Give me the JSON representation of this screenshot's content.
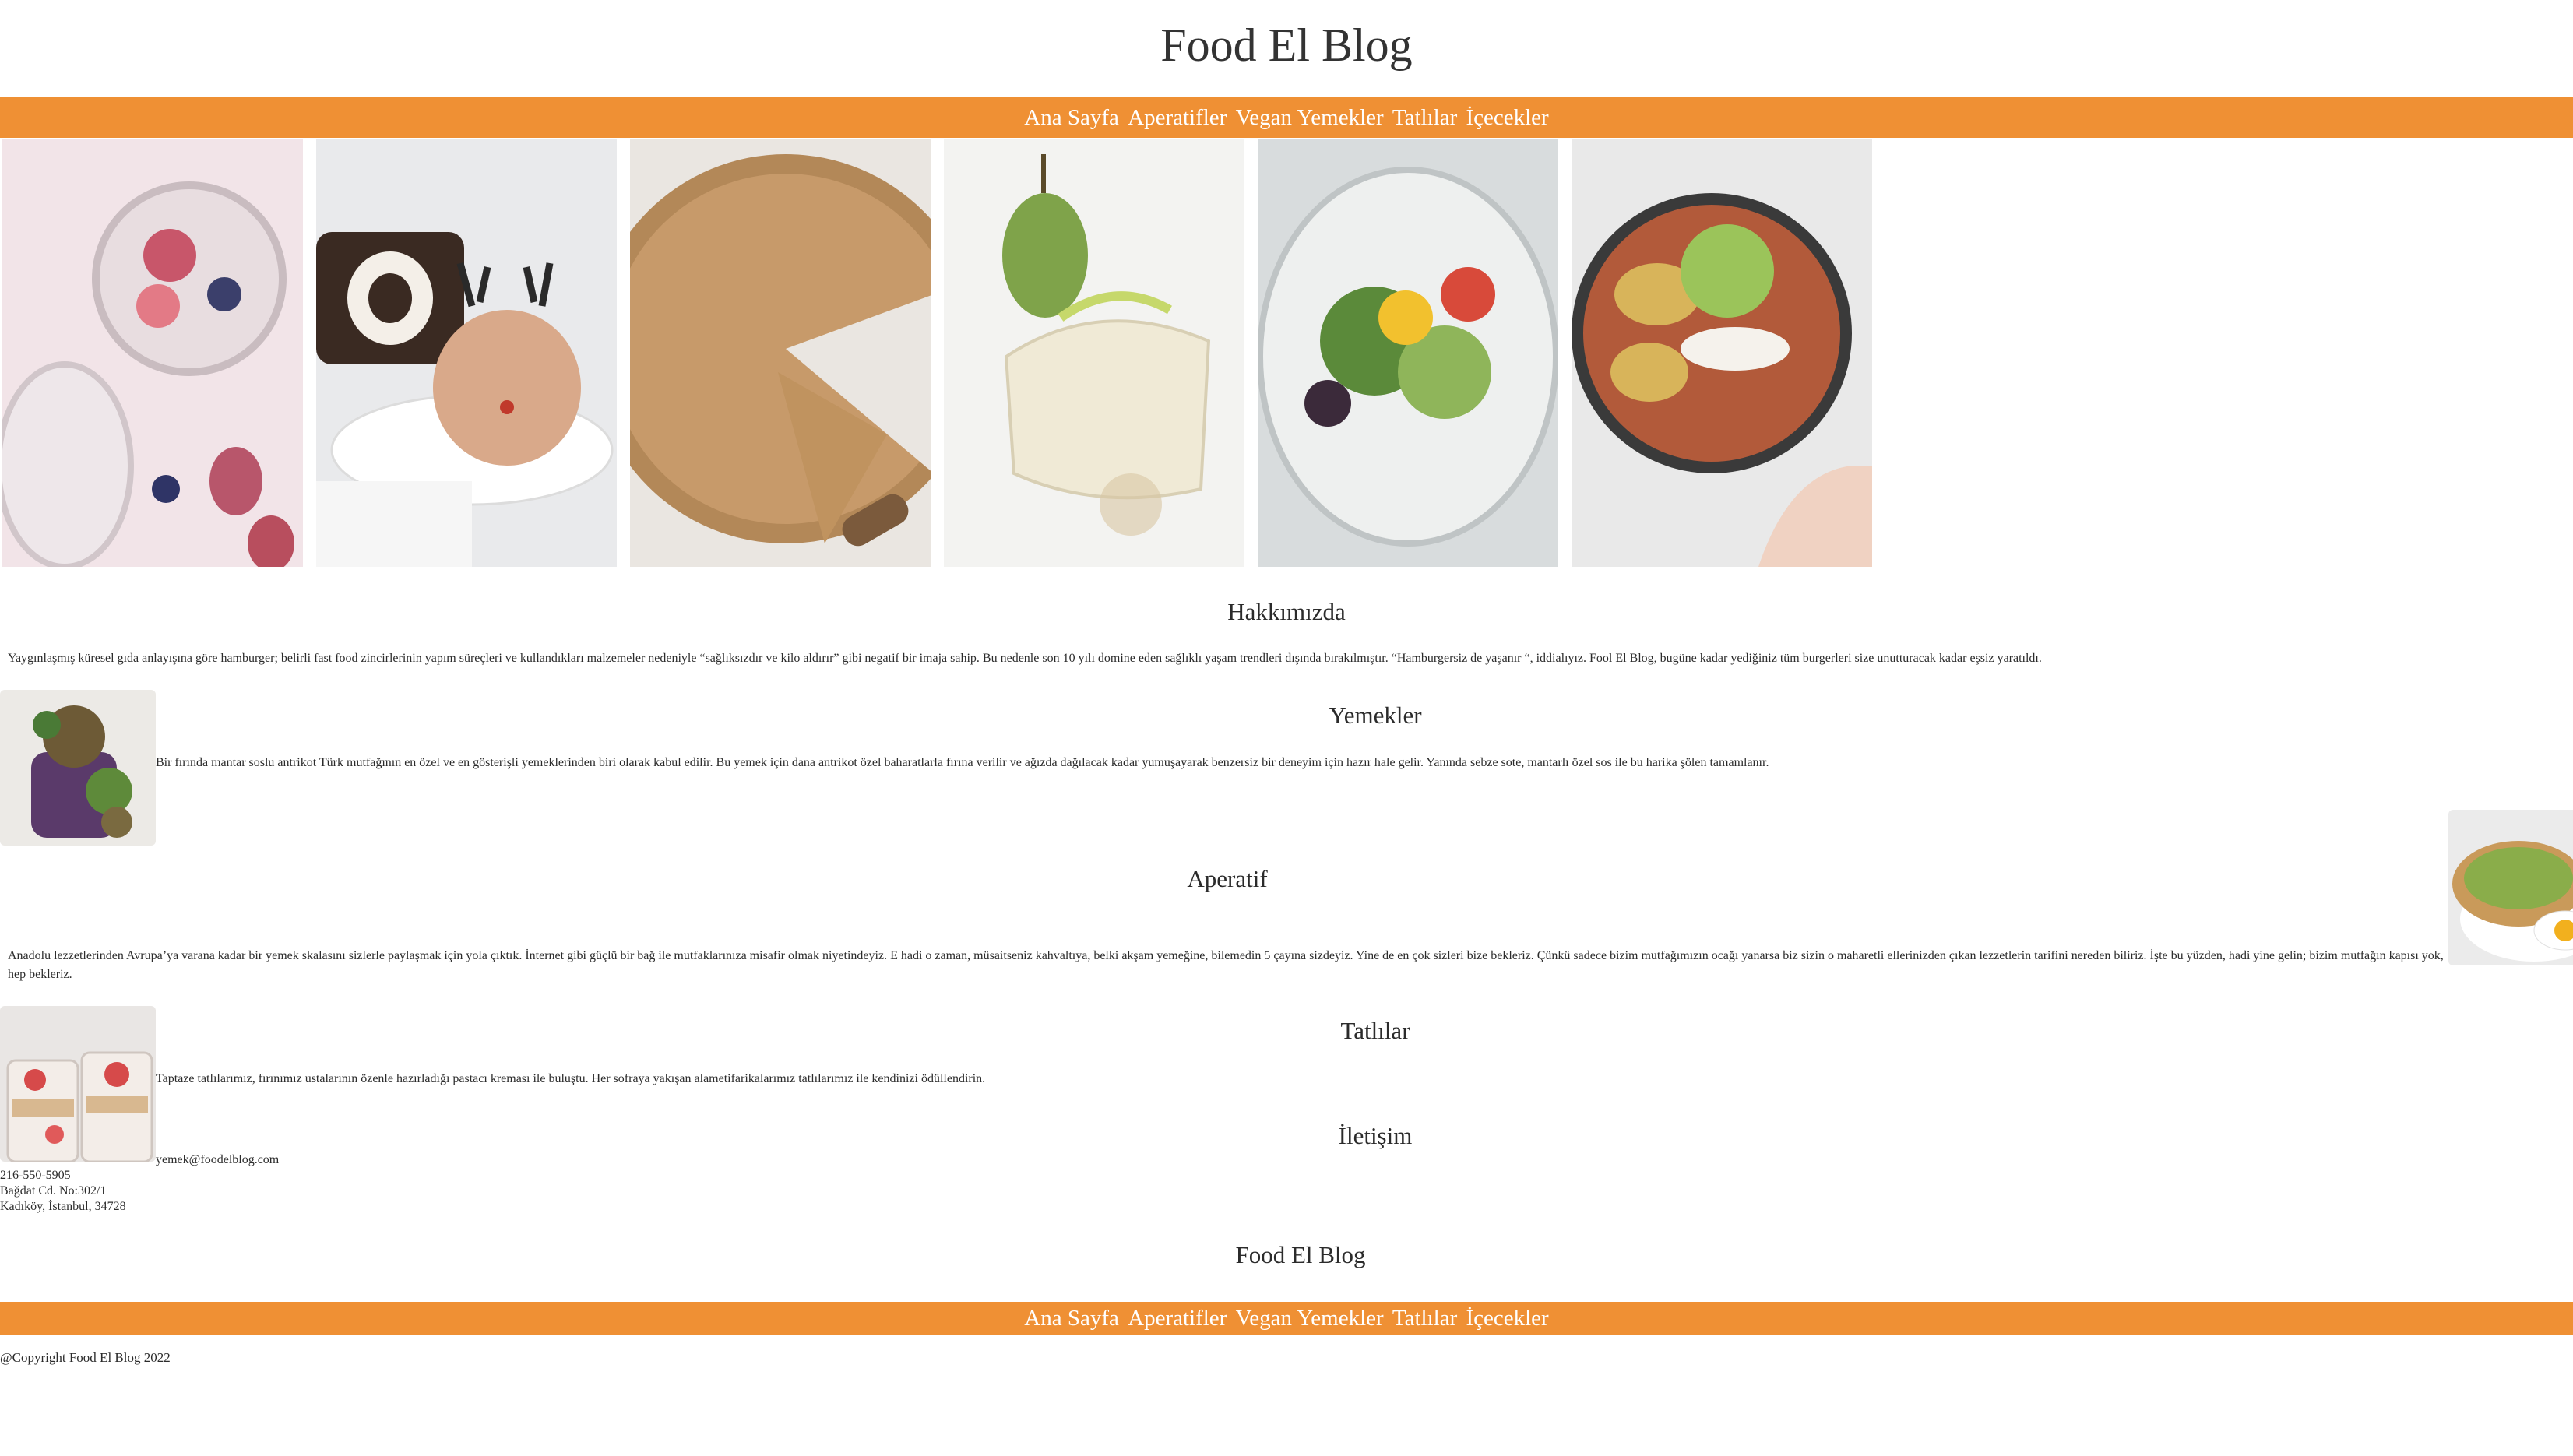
{
  "header": {
    "title": "Food El Blog"
  },
  "nav": {
    "items": [
      {
        "label": "Ana Sayfa"
      },
      {
        "label": "Aperatifler"
      },
      {
        "label": "Vegan Yemekler"
      },
      {
        "label": "Tatlılar"
      },
      {
        "label": "İçecekler"
      }
    ]
  },
  "gallery": {
    "images": [
      {
        "name": "chia-pudding-photo"
      },
      {
        "name": "reindeer-cake-photo"
      },
      {
        "name": "pie-photo"
      },
      {
        "name": "pear-dish-photo"
      },
      {
        "name": "salad-glass-photo"
      },
      {
        "name": "bowl-photo"
      }
    ]
  },
  "about": {
    "heading": "Hakkımızda",
    "text": "Yaygınlaşmış küresel gıda anlayışına göre hamburger; belirli fast food zincirlerinin yapım süreçleri ve kullandıkları malzemeler nedeniyle “sağlıksızdır ve kilo aldırır” gibi negatif bir imaja sahip. Bu nedenle son 10 yılı domine eden sağlıklı yaşam trendleri dışında bırakılmıştır. “Hamburgersiz de yaşanır “, iddialıyız. Fool El Blog, bugüne kadar yediğiniz tüm burgerleri size unutturacak kadar eşsiz yaratıldı."
  },
  "meals": {
    "heading": "Yemekler",
    "text": "Bir fırında mantar soslu antrikot Türk mutfağının en özel ve en gösterişli yemeklerinden biri olarak kabul edilir. Bu yemek için dana antrikot özel baharatlarla fırına verilir ve ağızda dağılacak kadar yumuşayarak benzersiz bir deneyim için hazır hale gelir. Yanında sebze sote, mantarlı özel sos ile bu harika şölen tamamlanır."
  },
  "appetizer": {
    "heading": "Aperatif",
    "text": "Anadolu lezzetlerinden Avrupa’ya varana kadar bir yemek skalasını sizlerle paylaşmak için yola çıktık. İnternet gibi güçlü bir bağ ile mutfaklarınıza misafir olmak niyetindeyiz. E hadi o zaman, müsaitseniz kahvaltıya, belki akşam yemeğine, bilemedin 5 çayına sizdeyiz. Yine de en çok sizleri bize bekleriz. Çünkü sadece bizim mutfağımızın ocağı yanarsa biz sizin o maharetli ellerinizden çıkan lezzetlerin tarifini nereden biliriz. İşte bu yüzden, hadi yine gelin; bizim mutfağın kapısı yok, hep bekleriz."
  },
  "desserts": {
    "heading": "Tatlılar",
    "text": "Taptaze tatlılarımız, fırınımız ustalarının özenle hazırladığı pastacı kreması ile buluştu. Her sofraya yakışan alametifarikalarımız tatlılarımız ile kendinizi ödüllendirin."
  },
  "contact": {
    "heading": "İletişim",
    "email": "yemek@foodelblog.com",
    "phone": "216-550-5905",
    "address1": "Bağdat Cd. No:302/1",
    "address2": "Kadıköy, İstanbul, 34728"
  },
  "footer": {
    "title": "Food El Blog",
    "copyright": "@Copyright Food El Blog 2022"
  },
  "colors": {
    "accent": "#ef9034",
    "text": "#2b2b2b",
    "background": "#ffffff"
  }
}
